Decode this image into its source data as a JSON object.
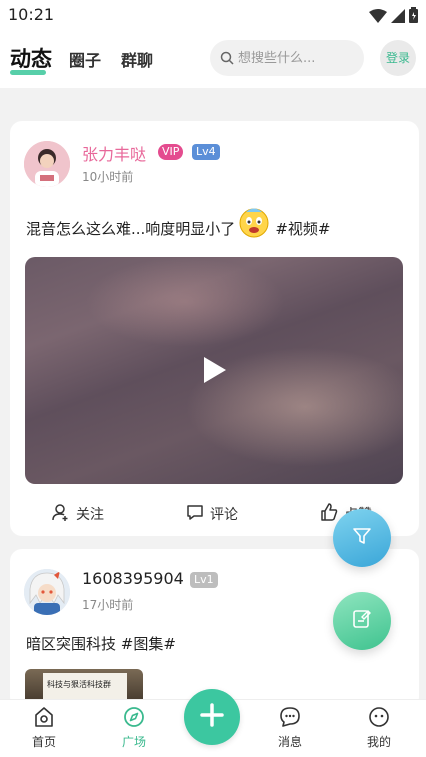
{
  "status_bar": {
    "time": "10:21"
  },
  "top_nav": {
    "tabs": [
      {
        "label": "动态",
        "active": true
      },
      {
        "label": "圈子",
        "active": false
      },
      {
        "label": "群聊",
        "active": false
      }
    ],
    "search": {
      "placeholder": "想搜些什么..."
    },
    "login_label": "登录"
  },
  "posts": [
    {
      "username": "张力丰哒",
      "badges": [
        "VIP",
        "Lv4"
      ],
      "time": "10小时前",
      "text": "混音怎么这么难...响度明显小了",
      "tag": "#视频#",
      "media": "video",
      "actions": [
        "关注",
        "评论",
        "点赞"
      ]
    },
    {
      "username": "1608395904",
      "badges": [
        "Lv1"
      ],
      "time": "17小时前",
      "text": "暗区突围科技 #图集#",
      "media": "image",
      "thumb_text": "科技与狠活科技群"
    }
  ],
  "bottom_nav": {
    "items": [
      {
        "label": "首页",
        "icon": "home-icon",
        "active": false
      },
      {
        "label": "广场",
        "icon": "compass-icon",
        "active": true
      },
      {
        "label": "消息",
        "icon": "message-icon",
        "active": false
      },
      {
        "label": "我的",
        "icon": "profile-face-icon",
        "active": false
      }
    ]
  },
  "colors": {
    "accent": "#3cc7a0",
    "username_pink": "#e8689a",
    "vip_badge": "#e44c8f",
    "lv4_badge": "#5b8fd8",
    "lv1_badge": "#bdbdbd"
  }
}
